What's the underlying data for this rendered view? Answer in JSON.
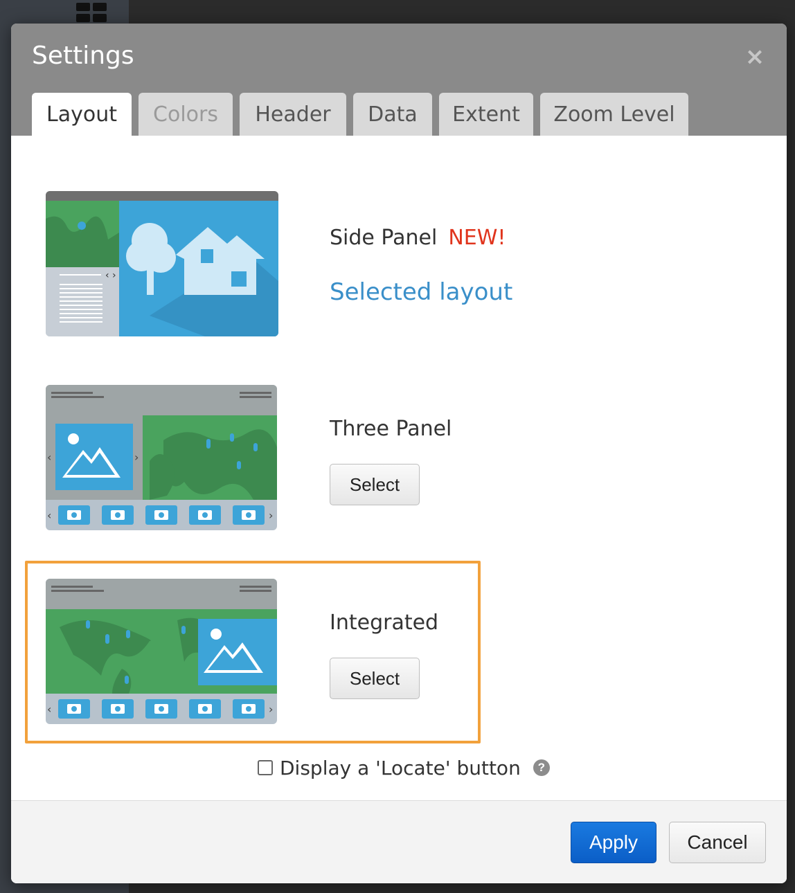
{
  "dialog": {
    "title": "Settings",
    "close_symbol": "×"
  },
  "tabs": [
    {
      "label": "Layout",
      "state": "active"
    },
    {
      "label": "Colors",
      "state": "disabled"
    },
    {
      "label": "Header",
      "state": "normal"
    },
    {
      "label": "Data",
      "state": "normal"
    },
    {
      "label": "Extent",
      "state": "normal"
    },
    {
      "label": "Zoom Level",
      "state": "normal"
    }
  ],
  "layouts": [
    {
      "name": "Side Panel",
      "badge": "NEW!",
      "status": "Selected layout"
    },
    {
      "name": "Three Panel",
      "button": "Select"
    },
    {
      "name": "Integrated",
      "button": "Select"
    }
  ],
  "locate_option": {
    "label": "Display a 'Locate' button",
    "checked": false,
    "help_symbol": "?"
  },
  "footer": {
    "apply_label": "Apply",
    "cancel_label": "Cancel"
  },
  "colors": {
    "header": "#8a8a8a",
    "accent_blue": "#3a8fc9",
    "badge_red": "#e0341c",
    "highlight_orange": "#f2a13c",
    "primary_button": "#0b5ec7"
  }
}
